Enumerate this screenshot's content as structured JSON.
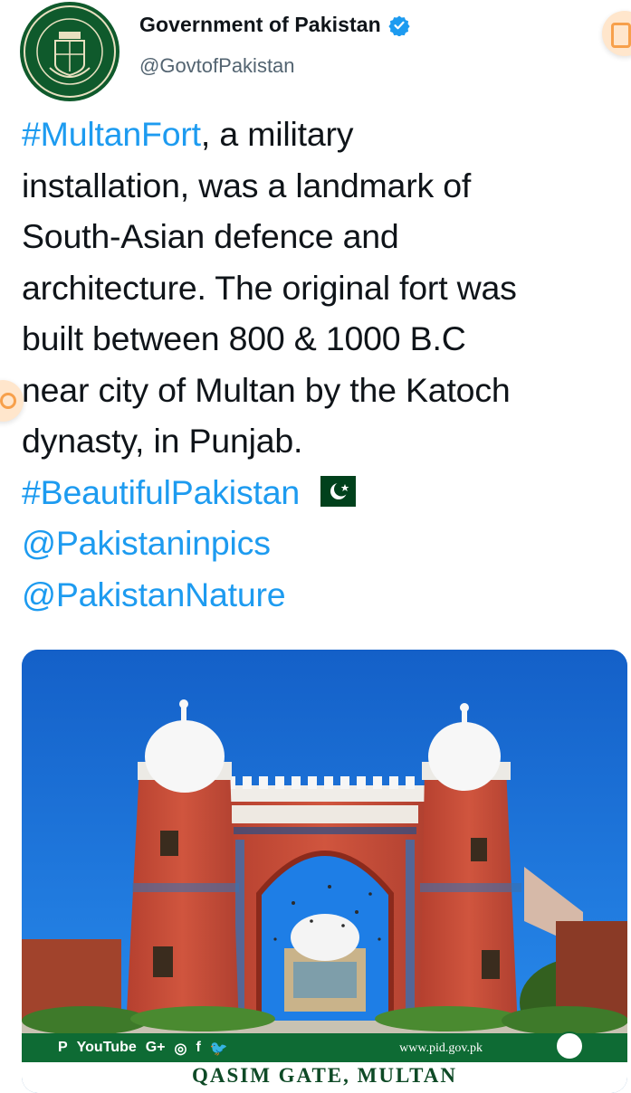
{
  "account": {
    "display_name": "Government of Pakistan",
    "handle": "@GovtofPakistan",
    "avatar_text": "GOVERNMENT OF PAKISTAN"
  },
  "tweet": {
    "lines": [
      {
        "link": "#MultanFort",
        "text": ", a military"
      },
      {
        "text": "installation, was a landmark of"
      },
      {
        "text": "South-Asian defence and"
      },
      {
        "text": "architecture. The original fort was"
      },
      {
        "text": "built between 800 & 1000 B.C"
      },
      {
        "text": "near city of Multan by the Katoch"
      },
      {
        "text": "dynasty, in Punjab."
      }
    ],
    "hashtag": "#BeautifulPakistan",
    "flag_icon": "pakistan-flag-icon",
    "mentions": [
      "@Pakistaninpics",
      "@PakistanNature"
    ]
  },
  "media": {
    "social_icons": [
      "P",
      "YouTube",
      "G+",
      "◎",
      "f",
      "🐦"
    ],
    "website": "www.pid.gov.pk",
    "caption": "QASIM GATE, MULTAN"
  },
  "colors": {
    "link": "#1d9bf0",
    "text": "#0f1419",
    "secondary": "#536471",
    "verified": "#1d9bf0",
    "brand_green": "#0e6b34"
  }
}
